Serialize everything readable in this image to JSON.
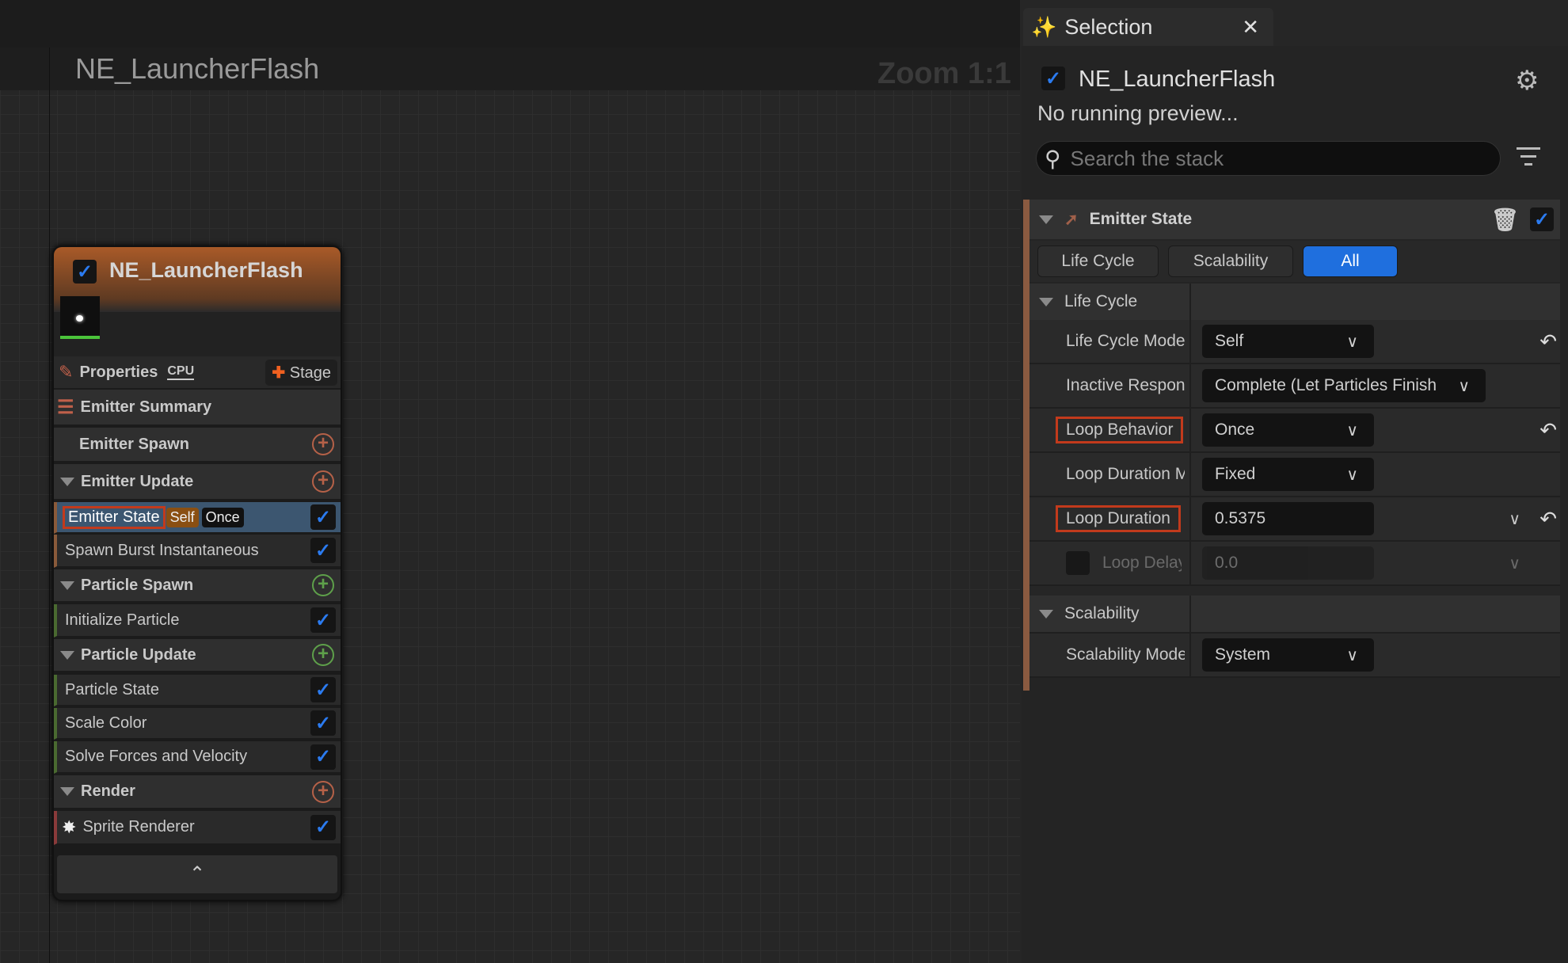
{
  "graph": {
    "title": "NE_LauncherFlash",
    "zoom": "Zoom 1:1"
  },
  "node": {
    "title": "NE_LauncherFlash",
    "enabled": true,
    "properties": "Properties",
    "cpu": "CPU",
    "stage": "Stage",
    "summary": "Emitter Summary",
    "rows": [
      {
        "label": "Emitter Spawn",
        "type": "hdr"
      },
      {
        "label": "Emitter Update",
        "type": "hdr"
      },
      {
        "label": "Emitter State",
        "type": "item",
        "badges": [
          "Self",
          "Once"
        ]
      },
      {
        "label": "Spawn Burst Instantaneous",
        "type": "item"
      },
      {
        "label": "Particle Spawn",
        "type": "hdr"
      },
      {
        "label": "Initialize Particle",
        "type": "item"
      },
      {
        "label": "Particle Update",
        "type": "hdr"
      },
      {
        "label": "Particle State",
        "type": "item"
      },
      {
        "label": "Scale Color",
        "type": "item"
      },
      {
        "label": "Solve Forces and Velocity",
        "type": "item"
      },
      {
        "label": "Render",
        "type": "hdr"
      },
      {
        "label": "Sprite Renderer",
        "type": "item"
      }
    ]
  },
  "panel": {
    "tab": "Selection",
    "title": "NE_LauncherFlash",
    "preview": "No running preview...",
    "search_placeholder": "Search the stack",
    "module": "Emitter State",
    "filters": [
      "Life Cycle",
      "Scalability",
      "All"
    ],
    "lifecycle": "Life Cycle",
    "props": [
      {
        "label": "Life Cycle Mode",
        "value": "Self"
      },
      {
        "label": "Inactive Response",
        "value": "Complete (Let Particles Finish"
      },
      {
        "label": "Loop Behavior",
        "value": "Once"
      },
      {
        "label": "Loop Duration Mode",
        "value": "Fixed"
      },
      {
        "label": "Loop Duration",
        "value": "0.5375"
      },
      {
        "label": "Loop Delay",
        "value": "0.0"
      }
    ],
    "scalability": "Scalability",
    "scal_prop": {
      "label": "Scalability Mode",
      "value": "System"
    }
  },
  "colors": {
    "accent": "#1f6fde",
    "highlight": "#c23a1c",
    "emitter": "#a95a28"
  }
}
